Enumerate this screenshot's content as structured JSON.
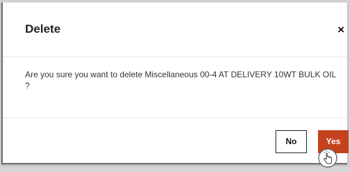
{
  "dialog": {
    "title": "Delete",
    "close_label": "×",
    "message": "Are you sure you want to delete Miscellaneous 00-4 AT DELIVERY 10WT BULK OIL ?",
    "buttons": {
      "no_label": "No",
      "yes_label": "Yes"
    }
  },
  "colors": {
    "accent": "#c5421f",
    "backdrop": "#d4d4d4"
  },
  "icons": {
    "cursor": "hand-pointer-click-icon"
  }
}
